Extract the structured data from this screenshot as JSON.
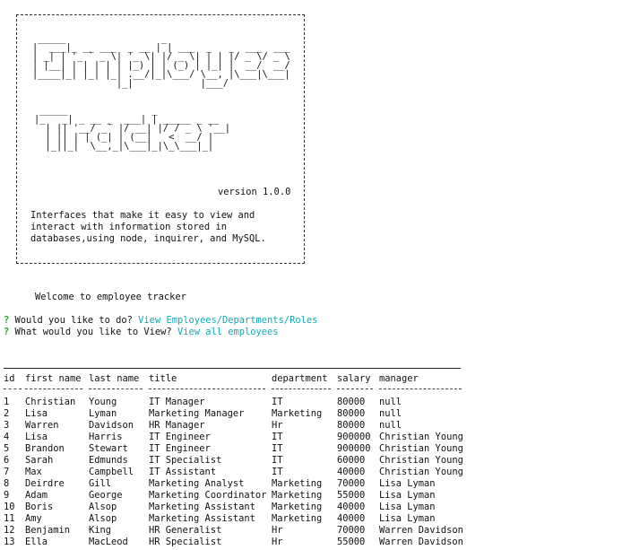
{
  "banner": {
    "art1": " _____                 _                       \n|  ___|_ __ ___  _ __ | | ___  _   _  ___  ___ \n| _| | '_ ` _ \\| '_ \\| |/ _ \\| | | |/ _ \\/ _ \\\n| |__| | | | | | |_) | | (_) | |_| |  __/  __/\n|____|_| |_| |_| .__/|_|\\___/ \\__, |\\___|\\___|\n               |_|            |___/           ",
    "art2": " _____               _             \n|_   _| _ __ _  ___| | _____ _ __ \n  | || '__/ _` |/ __| |/ / _ \\ '__|\n  | || | | (_| | (__|   <  __/ |   \n  |_||_|  \\__,_|\\___|_|\\_\\___|_|   ",
    "version": "version 1.0.0",
    "desc1": "Interfaces that make it easy to view and",
    "desc2": "interact with information stored in",
    "desc3": "databases,using node, inquirer, and MySQL."
  },
  "welcome": "Welcome to employee tracker",
  "prompts": [
    {
      "q": "?",
      "text": " Would you like to do?",
      "answer": "View Employees/Departments/Roles"
    },
    {
      "q": "?",
      "text": " What would you like to View?",
      "answer": "View all employees"
    }
  ],
  "table": {
    "headers": [
      "id",
      "first name",
      "last name",
      "title",
      "department",
      "salary",
      "manager"
    ],
    "rows": [
      [
        "1",
        "Christian",
        "Young",
        "IT Manager",
        "IT",
        "80000",
        "null"
      ],
      [
        "2",
        "Lisa",
        "Lyman",
        "Marketing Manager",
        "Marketing",
        "80000",
        "null"
      ],
      [
        "3",
        "Warren",
        "Davidson",
        "HR Manager",
        "Hr",
        "80000",
        "null"
      ],
      [
        "4",
        "Lisa",
        "Harris",
        "IT Engineer",
        "IT",
        "900000",
        "Christian Young"
      ],
      [
        "5",
        "Brandon",
        "Stewart",
        "IT Engineer",
        "IT",
        "900000",
        "Christian Young"
      ],
      [
        "6",
        "Sarah",
        "Edmunds",
        "IT Specialist",
        "IT",
        "60000",
        "Christian Young"
      ],
      [
        "7",
        "Max",
        "Campbell",
        "IT Assistant",
        "IT",
        "40000",
        "Christian Young"
      ],
      [
        "8",
        "Deirdre",
        "Gill",
        "Marketing Analyst",
        "Marketing",
        "70000",
        "Lisa Lyman"
      ],
      [
        "9",
        "Adam",
        "George",
        "Marketing Coordinator",
        "Marketing",
        "55000",
        "Lisa Lyman"
      ],
      [
        "10",
        "Boris",
        "Alsop",
        "Marketing Assistant",
        "Marketing",
        "40000",
        "Lisa Lyman"
      ],
      [
        "11",
        "Amy",
        "Alsop",
        "Marketing Assistant",
        "Marketing",
        "40000",
        "Lisa Lyman"
      ],
      [
        "12",
        "Benjamin",
        "King",
        "HR Generalist",
        "Hr",
        "70000",
        "Warren Davidson"
      ],
      [
        "13",
        "Ella",
        "MacLeod",
        "HR Specialist",
        "Hr",
        "55000",
        "Warren Davidson"
      ]
    ]
  }
}
